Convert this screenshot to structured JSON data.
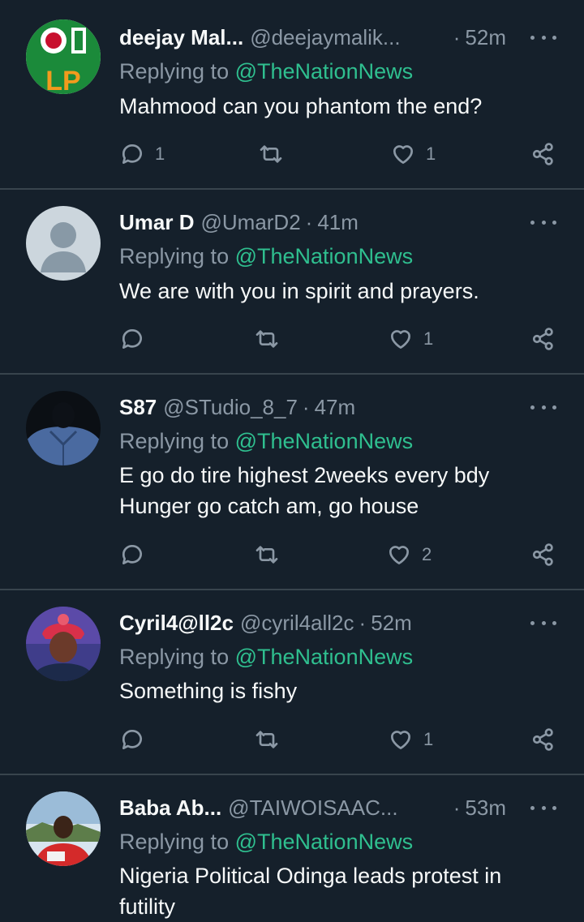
{
  "reply_prefix": "Replying to",
  "tweets": [
    {
      "name": "deejay Mal...",
      "handle": "@deejaymalik...",
      "time": "52m",
      "reply_to": "@TheNationNews",
      "lines": [
        "Mahmood can you phantom the end?"
      ],
      "reply_count": "1",
      "retweet_count": "",
      "like_count": "1",
      "avatar": "lp-logo"
    },
    {
      "name": "Umar D",
      "handle": "@UmarD2",
      "time": "41m",
      "reply_to": "@TheNationNews",
      "lines": [
        "We are with you in spirit and prayers."
      ],
      "reply_count": "",
      "retweet_count": "",
      "like_count": "1",
      "avatar": "default-profile"
    },
    {
      "name": "S87",
      "handle": "@STudio_8_7",
      "time": "47m",
      "reply_to": "@TheNationNews",
      "lines": [
        "E go do tire highest 2weeks every bdy",
        "Hunger go catch am, go house"
      ],
      "reply_count": "",
      "retweet_count": "",
      "like_count": "2",
      "avatar": "blue-shirt-photo"
    },
    {
      "name": "Cyril4@ll2c",
      "handle": "@cyril4all2c",
      "time": "52m",
      "reply_to": "@TheNationNews",
      "lines": [
        "Something is fishy"
      ],
      "reply_count": "",
      "retweet_count": "",
      "like_count": "1",
      "avatar": "red-headwrap-photo"
    },
    {
      "name": "Baba Ab...",
      "handle": "@TAIWOISAAC...",
      "time": "53m",
      "reply_to": "@TheNationNews",
      "lines": [
        "Nigeria Political Odinga leads protest in",
        "futility"
      ],
      "reply_count": "",
      "retweet_count": "",
      "like_count": "",
      "avatar": "red-shirt-photo"
    }
  ],
  "colors": {
    "background": "#15202b",
    "divider": "#38444d",
    "secondary_text": "#8b98a5",
    "mention": "#2fbf8f",
    "primary_text": "#f7f9f9"
  }
}
